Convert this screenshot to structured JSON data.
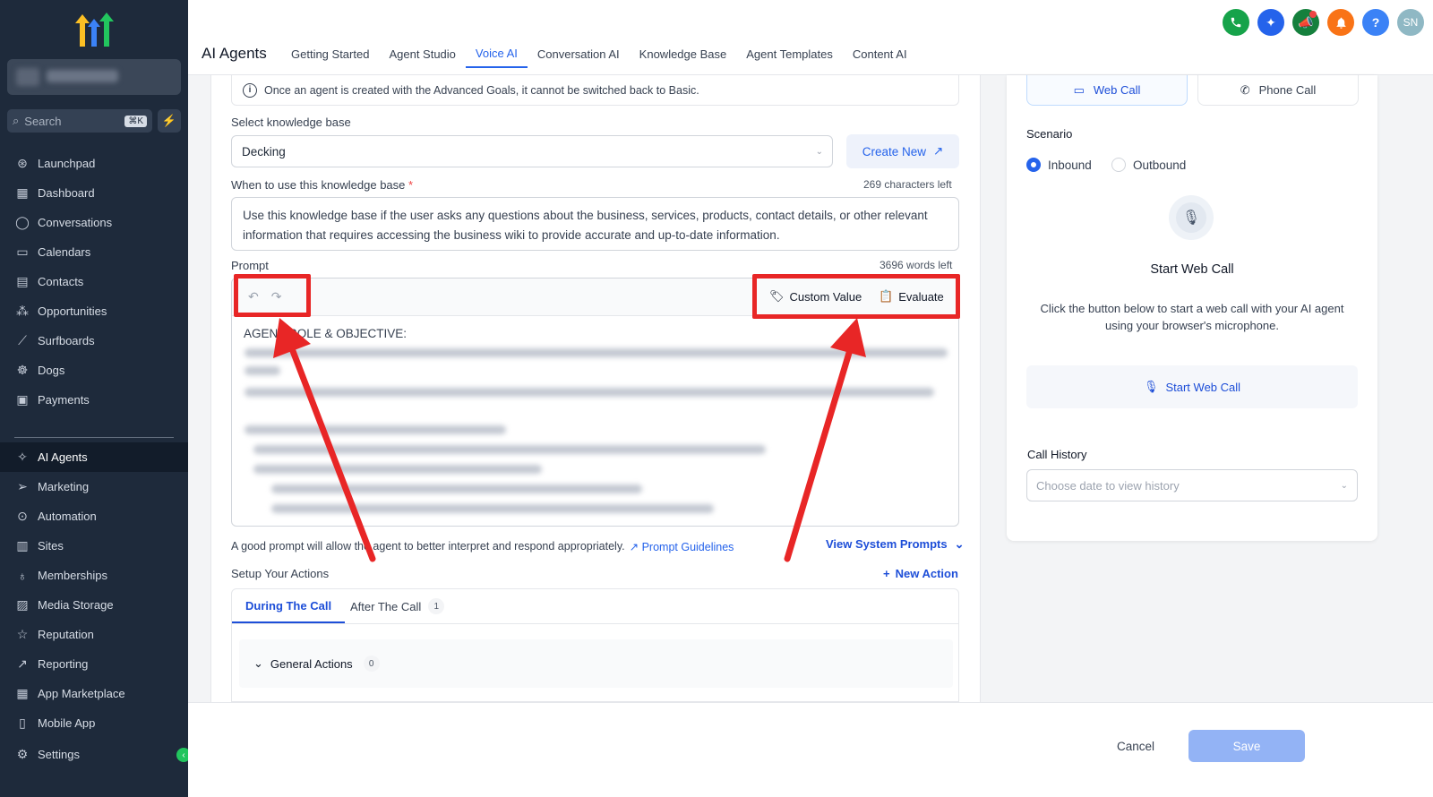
{
  "sidebar": {
    "search": {
      "placeholder": "Search",
      "shortcut": "⌘K"
    },
    "items": [
      {
        "label": "Launchpad",
        "icon": "rocket-icon",
        "glyph": "⊛"
      },
      {
        "label": "Dashboard",
        "icon": "dashboard-icon",
        "glyph": "▦"
      },
      {
        "label": "Conversations",
        "icon": "chat-icon",
        "glyph": "◯"
      },
      {
        "label": "Calendars",
        "icon": "calendar-icon",
        "glyph": "▭"
      },
      {
        "label": "Contacts",
        "icon": "contacts-icon",
        "glyph": "▤"
      },
      {
        "label": "Opportunities",
        "icon": "opportunities-icon",
        "glyph": "⁂"
      },
      {
        "label": "Surfboards",
        "icon": "surfboard-icon",
        "glyph": "⟋"
      },
      {
        "label": "Dogs",
        "icon": "dog-icon",
        "glyph": "☸"
      },
      {
        "label": "Payments",
        "icon": "payments-icon",
        "glyph": "▣"
      }
    ],
    "items2": [
      {
        "label": "AI Agents",
        "icon": "ai-sparkle-icon",
        "glyph": "✧",
        "active": true
      },
      {
        "label": "Marketing",
        "icon": "send-icon",
        "glyph": "➢"
      },
      {
        "label": "Automation",
        "icon": "automation-icon",
        "glyph": "⊙"
      },
      {
        "label": "Sites",
        "icon": "sites-icon",
        "glyph": "▥"
      },
      {
        "label": "Memberships",
        "icon": "membership-icon",
        "glyph": "♁"
      },
      {
        "label": "Media Storage",
        "icon": "media-icon",
        "glyph": "▨"
      },
      {
        "label": "Reputation",
        "icon": "star-icon",
        "glyph": "☆"
      },
      {
        "label": "Reporting",
        "icon": "chart-icon",
        "glyph": "↗"
      },
      {
        "label": "App Marketplace",
        "icon": "apps-icon",
        "glyph": "▦"
      },
      {
        "label": "Mobile App",
        "icon": "mobile-icon",
        "glyph": "▯"
      }
    ],
    "settings": {
      "label": "Settings",
      "icon": "gear-icon",
      "glyph": "⚙"
    }
  },
  "header": {
    "title": "AI Agents",
    "tabs": [
      "Getting Started",
      "Agent Studio",
      "Voice AI",
      "Conversation AI",
      "Knowledge Base",
      "Agent Templates",
      "Content AI"
    ],
    "active_tab": "Voice AI",
    "avatar": "SN",
    "icon_colors": {
      "phone": "#16a34a",
      "sparkle": "#2563eb",
      "megaphone": "#15803d",
      "bell": "#f97316",
      "help": "#3b82f6",
      "avatar": "#8fb8c4"
    }
  },
  "form": {
    "info_note": "Once an agent is created with the Advanced Goals, it cannot be switched back to Basic.",
    "kb_label": "Select knowledge base",
    "kb_value": "Decking",
    "create_new": "Create New",
    "when_label": "When to use this knowledge base",
    "required_mark": "*",
    "chars_left": "269 characters left",
    "when_text": "Use this knowledge base if the user asks any questions about the business, services, products, contact details, or other relevant information that requires accessing the business wiki to provide accurate and up-to-date information.",
    "prompt_label": "Prompt",
    "words_left": "3696 words left",
    "custom_value": "Custom Value",
    "evaluate": "Evaluate",
    "prompt_heading": "AGENT ROLE & OBJECTIVE:",
    "hint": "A good prompt will allow the agent to better interpret and respond appropriately.",
    "prompt_guidelines": "Prompt Guidelines",
    "view_system_prompts": "View System Prompts",
    "setup_actions": "Setup Your Actions",
    "new_action": "New Action",
    "tab_during": "During The Call",
    "tab_after": "After The Call",
    "after_count": "1",
    "general_actions": "General Actions",
    "general_count": "0"
  },
  "right": {
    "web_call": "Web Call",
    "phone_call": "Phone Call",
    "scenario": "Scenario",
    "inbound": "Inbound",
    "outbound": "Outbound",
    "selected_scenario": "Inbound",
    "start_title": "Start Web Call",
    "start_desc": "Click the button below to start a web call with your AI agent using your browser's microphone.",
    "start_button": "Start Web Call",
    "history_label": "Call History",
    "history_placeholder": "Choose date to view history"
  },
  "footer": {
    "cancel": "Cancel",
    "save": "Save"
  },
  "annotation_color": "#e82626"
}
